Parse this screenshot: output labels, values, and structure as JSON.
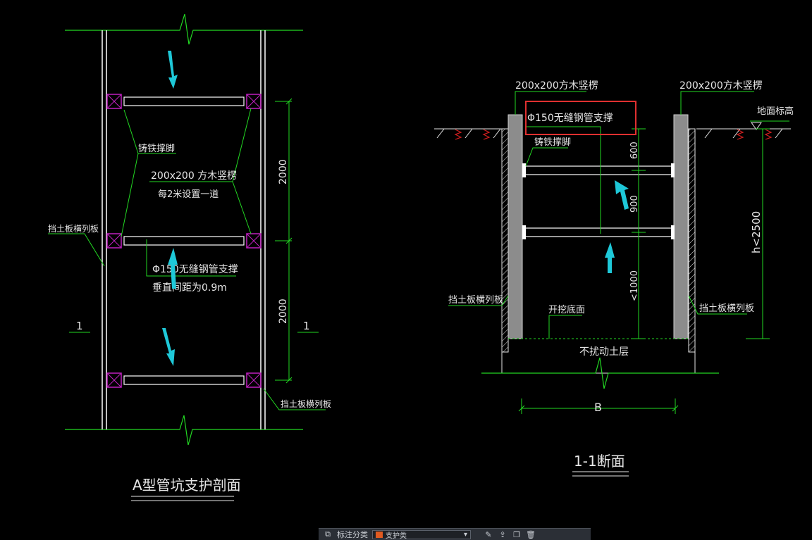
{
  "colors": {
    "background": "#000000",
    "line_green": "#22d822",
    "line_white": "#ffffff",
    "label_white": "#e6e6e6",
    "magenta": "#c020c0",
    "cyan_arrow": "#1ec8d8",
    "highlight_red": "#e03030",
    "ground_red": "#d82020",
    "swatch": "#e05a20"
  },
  "left_drawing": {
    "label_cast_iron_foot": "铸铁撑脚",
    "label_timber_post": "200x200 方木竖楞",
    "label_post_interval": "每2米设置一道",
    "label_retaining_board_left": "挡土板横列板",
    "label_pipe_support": "Φ150无缝钢管支撑",
    "label_vertical_spacing": "垂直间距为0.9m",
    "label_retaining_board_bottom": "挡土板横列板",
    "section_mark_left": "1",
    "section_mark_right": "1",
    "dim_upper": "2000",
    "dim_lower": "2000",
    "title": "A型管坑支护剖面"
  },
  "right_drawing": {
    "label_timber_post_left": "200x200方木竖楞",
    "label_timber_post_right": "200x200方木竖楞",
    "label_pipe_support_highlighted": "Φ150无缝钢管支撑",
    "label_ground_level": "地面标高",
    "label_cast_iron_foot": "铸铁撑脚",
    "dim_600": "600",
    "dim_900": "900",
    "dim_1000": "<1000",
    "dim_h": "h<2500",
    "label_retaining_board_left": "挡土板横列板",
    "label_retaining_board_right": "挡土板横列板",
    "label_excavation_bottom": "开挖底面",
    "label_undisturbed_soil": "不扰动土层",
    "dim_width": "B",
    "title": "1-1断面"
  },
  "toolbar": {
    "layer_label": "标注分类",
    "layer_value": "支护类",
    "icons": [
      "layers-icon",
      "edit-icon",
      "export-icon",
      "copy-icon",
      "delete-icon"
    ]
  }
}
